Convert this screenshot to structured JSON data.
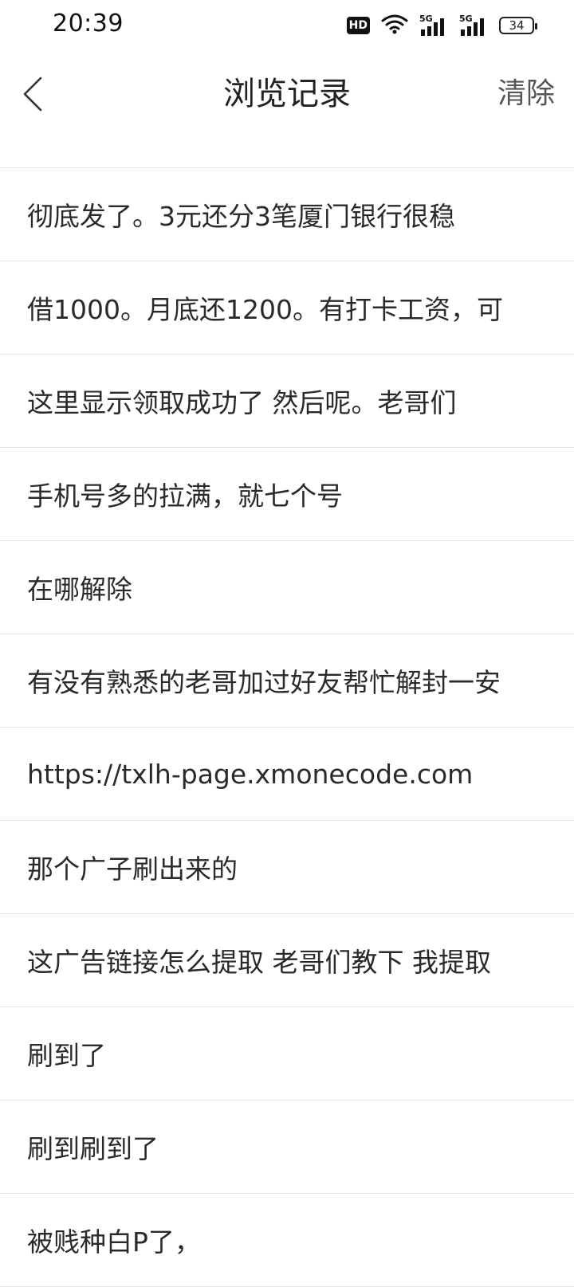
{
  "status_bar": {
    "time": "20:39",
    "hd_label": "HD",
    "network1": "5G",
    "network2": "5G",
    "battery": "34"
  },
  "header": {
    "title": "浏览记录",
    "clear_label": "清除"
  },
  "history": [
    "彻底发了。3元还分3笔厦门银行很稳",
    "借1000。月底还1200。有打卡工资，可",
    "这里显示领取成功了 然后呢。老哥们",
    "手机号多的拉满，就七个号",
    "在哪解除",
    "有没有熟悉的老哥加过好友帮忙解封一安",
    "https://txlh-page.xmonecode.com",
    "那个广子刷出来的",
    "这广告链接怎么提取 老哥们教下 我提取",
    "刷到了",
    "刷到刷到了",
    "被贱种白P了，"
  ]
}
